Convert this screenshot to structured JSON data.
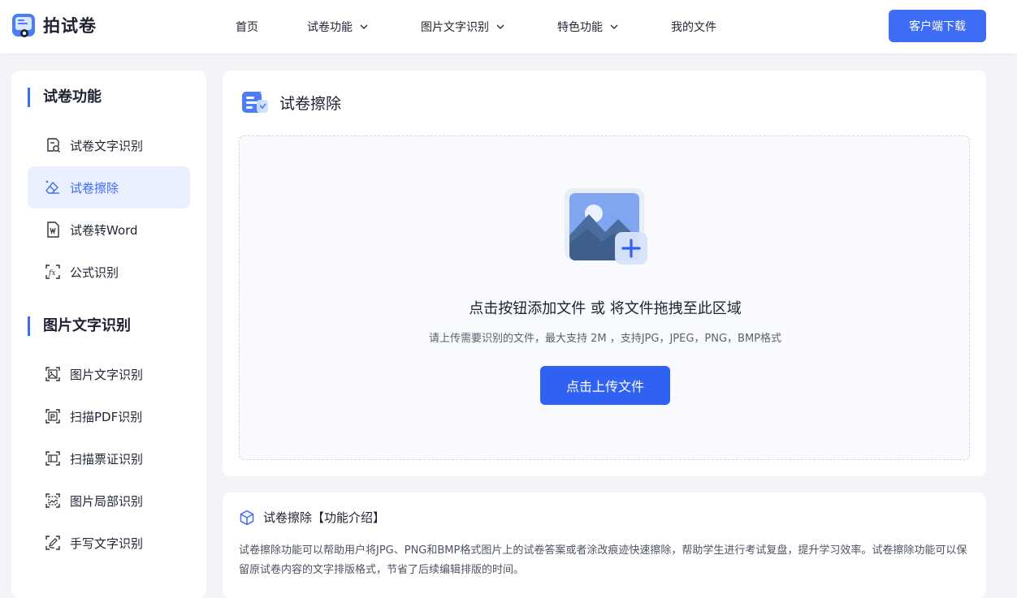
{
  "brand": {
    "name": "拍试卷"
  },
  "nav": [
    {
      "label": "首页",
      "dropdown": false
    },
    {
      "label": "试卷功能",
      "dropdown": true
    },
    {
      "label": "图片文字识别",
      "dropdown": true
    },
    {
      "label": "特色功能",
      "dropdown": true
    },
    {
      "label": "我的文件",
      "dropdown": false
    }
  ],
  "download_button": "客户端下载",
  "sidebar": {
    "sections": [
      {
        "title": "试卷功能",
        "items": [
          {
            "label": "试卷文字识别",
            "icon": "doc-search-icon",
            "active": false
          },
          {
            "label": "试卷擦除",
            "icon": "eraser-icon",
            "active": true
          },
          {
            "label": "试卷转Word",
            "icon": "word-doc-icon",
            "active": false
          },
          {
            "label": "公式识别",
            "icon": "formula-icon",
            "active": false
          }
        ]
      },
      {
        "title": "图片文字识别",
        "items": [
          {
            "label": "图片文字识别",
            "icon": "image-scan-icon",
            "active": false
          },
          {
            "label": "扫描PDF识别",
            "icon": "pdf-scan-icon",
            "active": false
          },
          {
            "label": "扫描票证识别",
            "icon": "ticket-scan-icon",
            "active": false
          },
          {
            "label": "图片局部识别",
            "icon": "partial-scan-icon",
            "active": false
          },
          {
            "label": "手写文字识别",
            "icon": "handwriting-icon",
            "active": false
          }
        ]
      }
    ]
  },
  "main": {
    "title": "试卷擦除",
    "dropzone": {
      "main_text": "点击按钮添加文件 或 将文件拖拽至此区域",
      "sub_text": "请上传需要识别的文件，最大支持 2M ，支持JPG，JPEG，PNG，BMP格式",
      "button_label": "点击上传文件"
    }
  },
  "intro": {
    "title": "试卷擦除【功能介绍】",
    "body": "试卷擦除功能可以帮助用户将JPG、PNG和BMP格式图片上的试卷答案或者涂改痕迹快速擦除，帮助学生进行考试复盘，提升学习效率。试卷擦除功能可以保留原试卷内容的文字排版格式，节省了后续编辑排版的时间。"
  },
  "colors": {
    "accent": "#3f6cf5",
    "active_bg": "#e9effd",
    "page_bg": "#f2f4f7"
  }
}
